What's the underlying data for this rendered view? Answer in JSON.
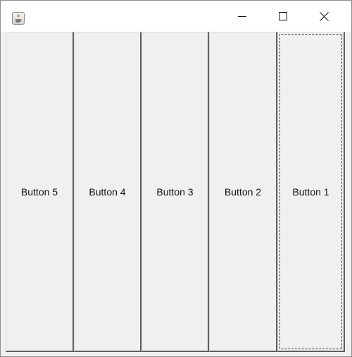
{
  "window": {
    "icon": "java-cup-icon",
    "controls": {
      "minimize_icon": "minimize-icon",
      "maximize_icon": "maximize-icon",
      "close_icon": "close-icon"
    }
  },
  "buttons": [
    {
      "label": "Button 5"
    },
    {
      "label": "Button 4"
    },
    {
      "label": "Button 3"
    },
    {
      "label": "Button 2"
    },
    {
      "label": "Button 1",
      "focused": true
    }
  ]
}
